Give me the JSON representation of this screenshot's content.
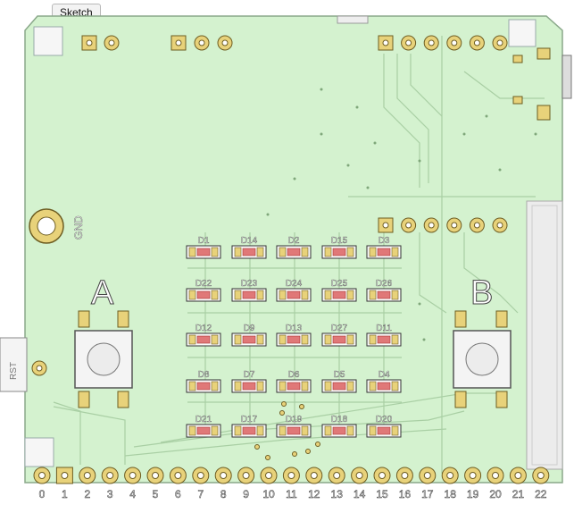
{
  "tab": {
    "label": "Sketch"
  },
  "board": {
    "colors": {
      "board_fill": "#d4f2cf",
      "board_edge": "#8aa88a",
      "pad": "#e8d27a",
      "pad_ring": "#6d5d22",
      "trace": "#9fc69a",
      "led_red": "#e07878"
    },
    "labels": {
      "gnd": "GND",
      "button_a": "A",
      "button_b": "B",
      "reset_mark": "RST"
    },
    "leds": [
      [
        "D1",
        "D14",
        "D2",
        "D15",
        "D3"
      ],
      [
        "D22",
        "D23",
        "D24",
        "D25",
        "D26"
      ],
      [
        "D12",
        "D9",
        "D13",
        "D27",
        "D11"
      ],
      [
        "D8",
        "D7",
        "D6",
        "D5",
        "D4"
      ],
      [
        "D21",
        "D17",
        "D19",
        "D18",
        "D20"
      ]
    ],
    "pins": [
      "0",
      "1",
      "2",
      "3",
      "4",
      "5",
      "6",
      "7",
      "8",
      "9",
      "10",
      "11",
      "12",
      "13",
      "14",
      "15",
      "16",
      "17",
      "18",
      "19",
      "20",
      "21",
      "22"
    ]
  }
}
